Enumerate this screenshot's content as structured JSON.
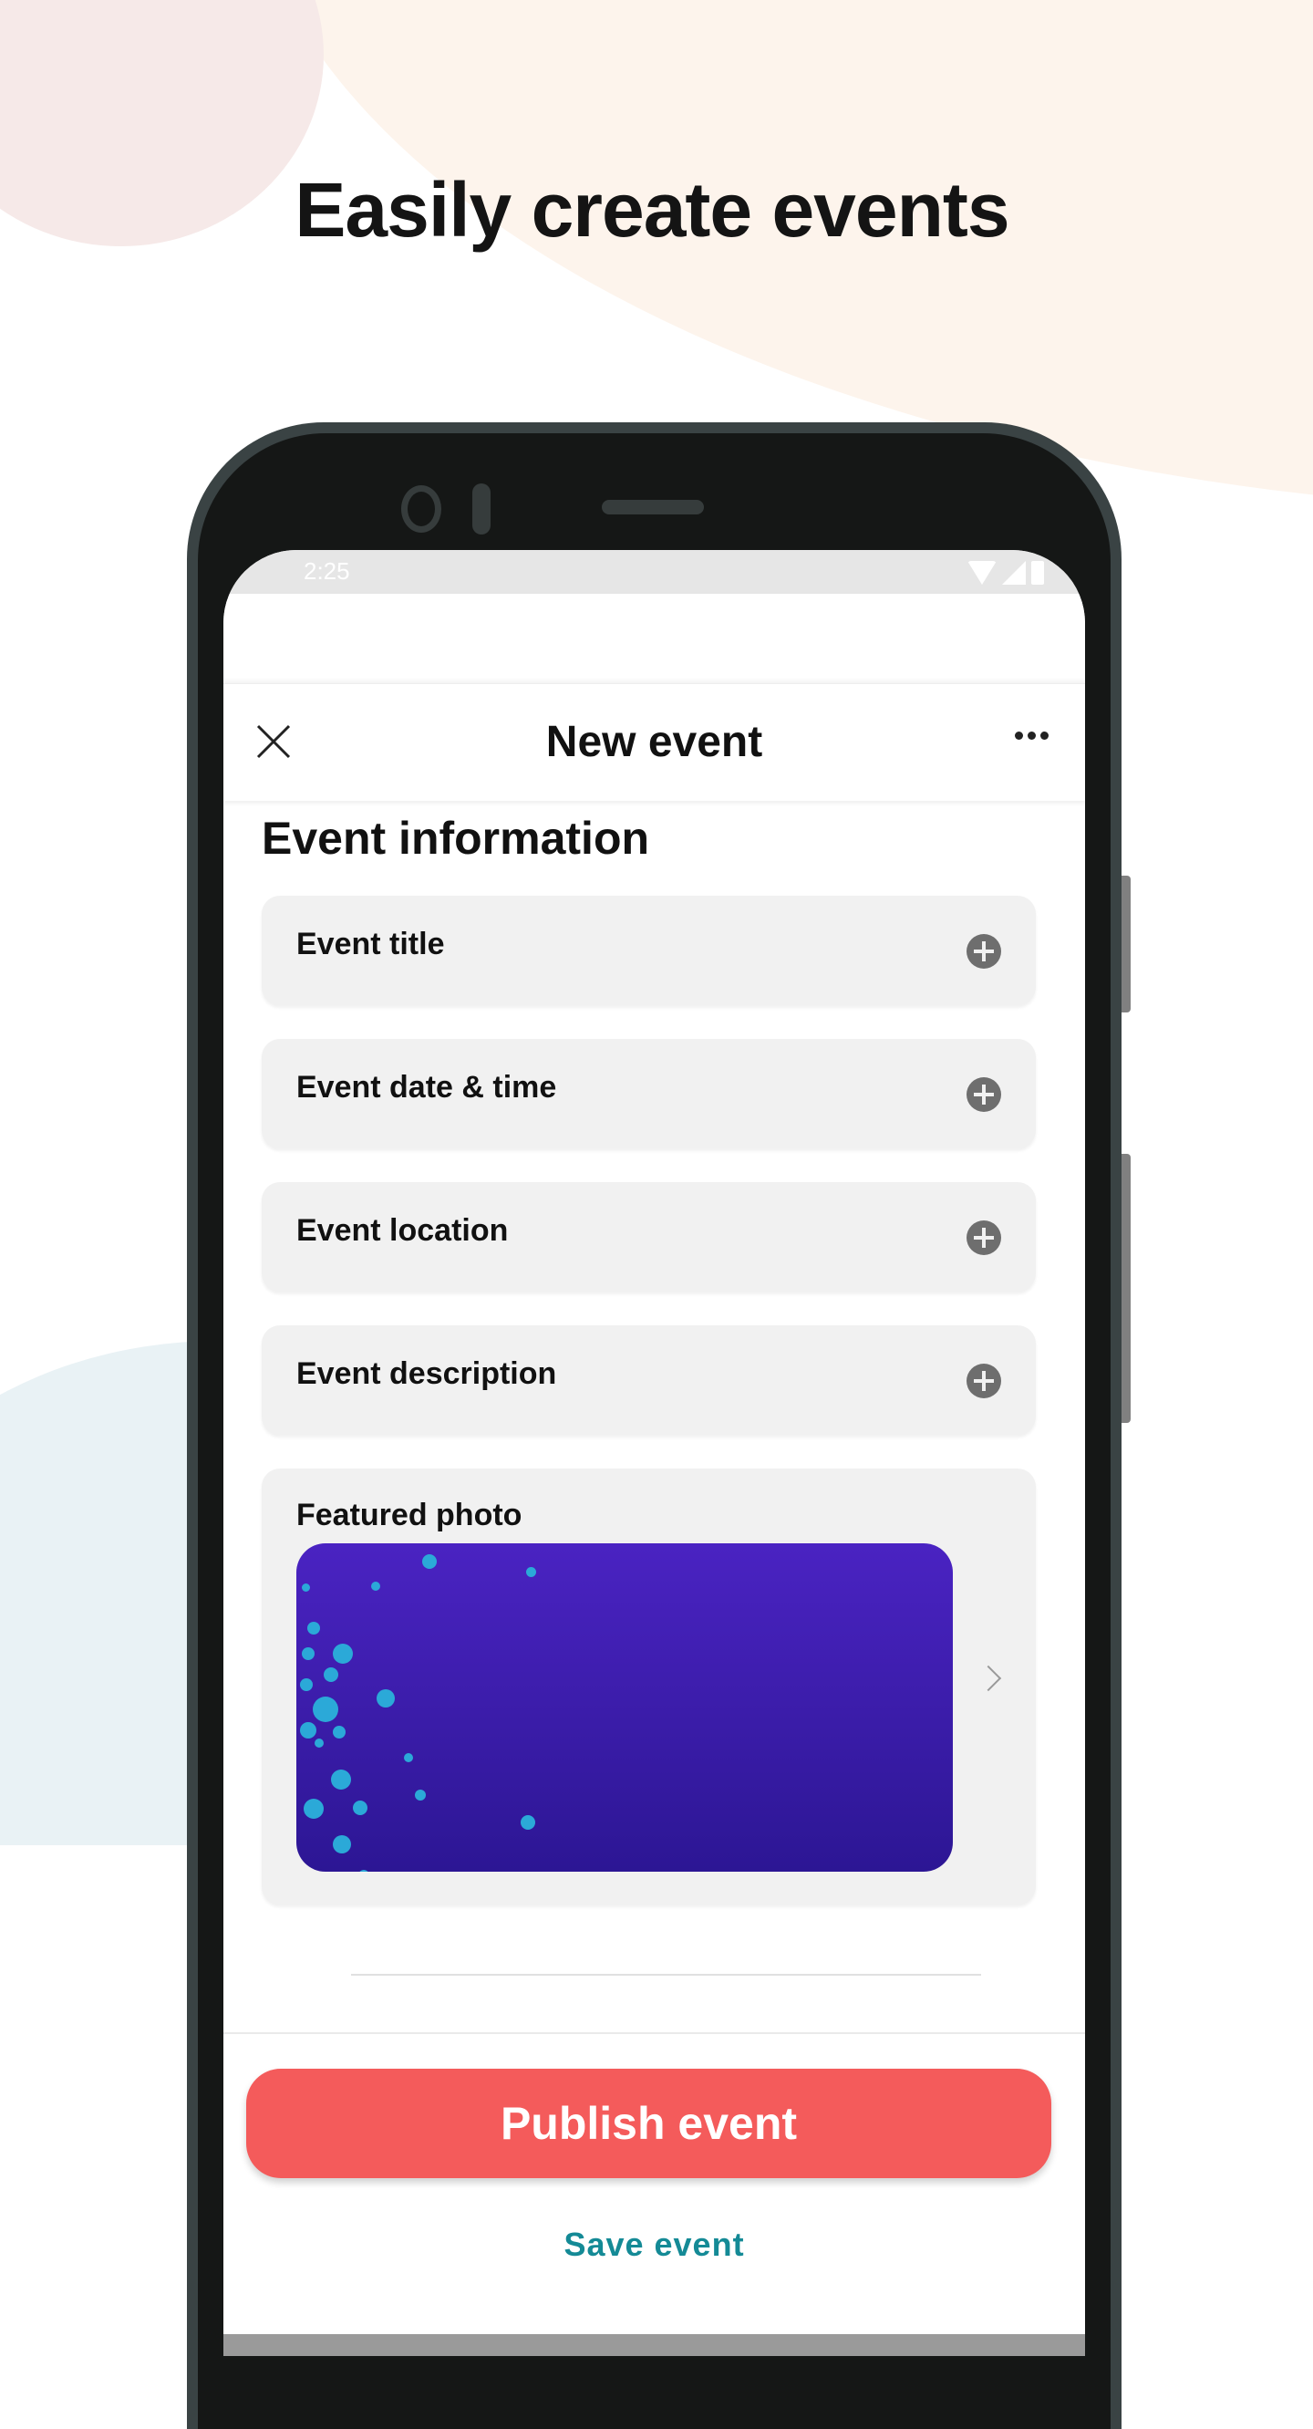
{
  "headline": "Easily create events",
  "statusbar": {
    "time": "2:25",
    "icons": [
      "wifi-icon",
      "signal-icon",
      "battery-icon"
    ]
  },
  "appbar": {
    "title": "New event",
    "close_icon": "close-icon",
    "more_icon": "more-horizontal-icon"
  },
  "section": {
    "title": "Event information"
  },
  "fields": [
    {
      "label": "Event title",
      "icon": "plus-circle-icon"
    },
    {
      "label": "Event date & time",
      "icon": "plus-circle-icon"
    },
    {
      "label": "Event location",
      "icon": "plus-circle-icon"
    },
    {
      "label": "Event description",
      "icon": "plus-circle-icon"
    }
  ],
  "featured_photo": {
    "label": "Featured photo",
    "chevron_icon": "chevron-right-icon"
  },
  "actions": {
    "publish": "Publish event",
    "save": "Save event"
  },
  "colors": {
    "primary": "#f45b5b",
    "link": "#148a96",
    "card_bg": "#f1f1f1",
    "photo_top": "#4a23c2",
    "photo_bottom": "#2c1694",
    "dots": "#2ba9d8"
  }
}
